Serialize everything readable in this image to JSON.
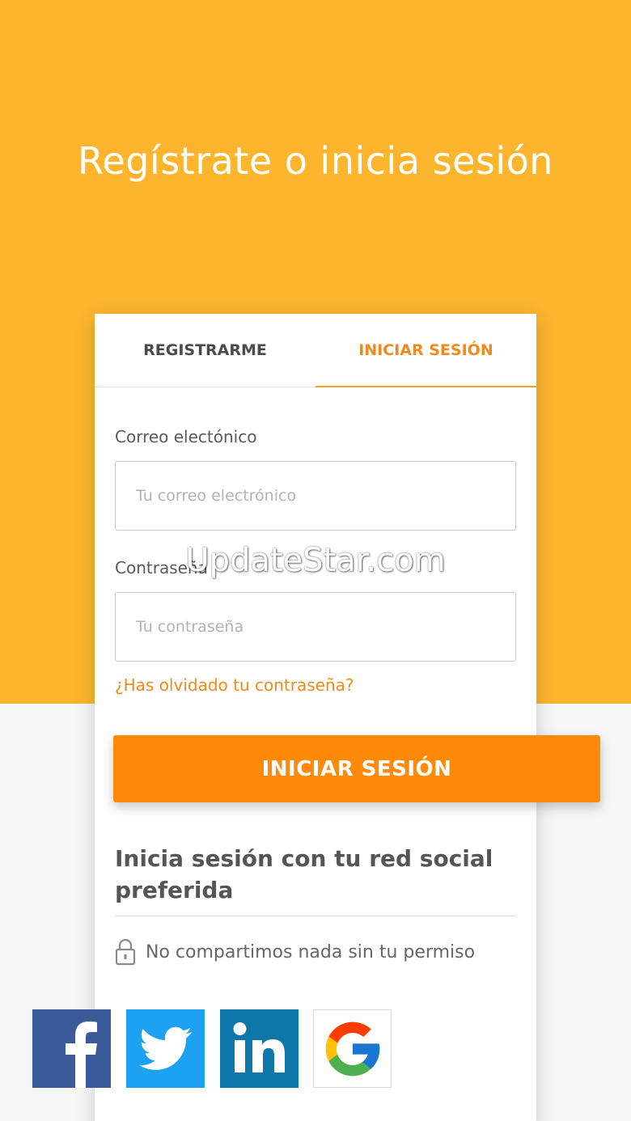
{
  "header": {
    "title": "Regístrate o inicia sesión"
  },
  "tabs": [
    {
      "label": "REGISTRARME",
      "active": false
    },
    {
      "label": "INICIAR SESIÓN",
      "active": true
    }
  ],
  "form": {
    "email_label": "Correo electónico",
    "email_placeholder": "Tu correo electrónico",
    "password_label": "Contraseña",
    "password_placeholder": "Tu contraseña",
    "forgot_link": "¿Has olvidado tu contraseña?",
    "submit_label": "INICIAR SESIÓN"
  },
  "social": {
    "heading": "Inicia sesión con tu red social preferida",
    "privacy_note": "No compartimos nada sin tu permiso",
    "providers": [
      "facebook-icon",
      "twitter-icon",
      "linkedin-icon",
      "google-icon"
    ]
  },
  "watermark": "UpdateStar.com",
  "colors": {
    "accent_yellow": "#fdb52e",
    "accent_orange": "#ff8a0a",
    "facebook": "#3b5a9a",
    "twitter": "#1da1f2",
    "linkedin": "#0e76a8"
  }
}
